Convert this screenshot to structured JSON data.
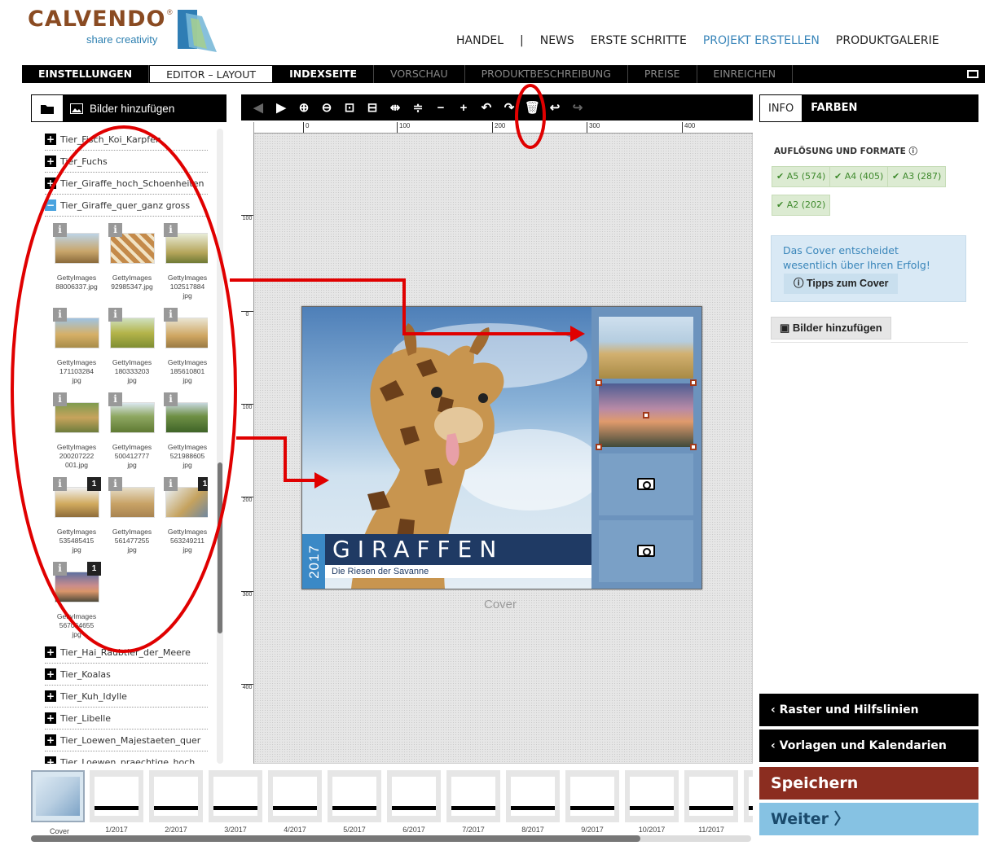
{
  "header": {
    "brand": "CALVENDO",
    "registered": "®",
    "tagline": "share creativity",
    "nav": [
      "HANDEL",
      "|",
      "NEWS",
      "ERSTE SCHRITTE",
      "PROJEKT ERSTELLEN",
      "PRODUKTGALERIE"
    ]
  },
  "tabs": [
    "EINSTELLUNGEN",
    "EDITOR – LAYOUT",
    "INDEXSEITE",
    "VORSCHAU",
    "PRODUKTBESCHREIBUNG",
    "PREISE",
    "EINREICHEN"
  ],
  "left_panel": {
    "add_images": "Bilder hinzufügen",
    "folders_top": [
      {
        "name": "Tier_Fisch_Koi_Karpfen",
        "state": "+"
      },
      {
        "name": "Tier_Fuchs",
        "state": "+"
      },
      {
        "name": "Tier_Giraffe_hoch_Schoenheiten",
        "state": "+"
      },
      {
        "name": "Tier_Giraffe_quer_ganz gross",
        "state": "−"
      }
    ],
    "thumbs": [
      {
        "cap1": "GettyImages",
        "cap2": "88006337.jpg",
        "cap3": "",
        "count": ""
      },
      {
        "cap1": "GettyImages",
        "cap2": "92985347.jpg",
        "cap3": "",
        "count": ""
      },
      {
        "cap1": "GettyImages",
        "cap2": "102517884",
        "cap3": "jpg",
        "count": ""
      },
      {
        "cap1": "GettyImages",
        "cap2": "171103284",
        "cap3": "jpg",
        "count": ""
      },
      {
        "cap1": "GettyImages",
        "cap2": "180333203",
        "cap3": "jpg",
        "count": ""
      },
      {
        "cap1": "GettyImages",
        "cap2": "185610801",
        "cap3": "jpg",
        "count": ""
      },
      {
        "cap1": "GettyImages",
        "cap2": "200207222",
        "cap3": "001.jpg",
        "count": ""
      },
      {
        "cap1": "GettyImages",
        "cap2": "500412777",
        "cap3": "jpg",
        "count": ""
      },
      {
        "cap1": "GettyImages",
        "cap2": "521988605",
        "cap3": "jpg",
        "count": ""
      },
      {
        "cap1": "GettyImages",
        "cap2": "535485415",
        "cap3": "jpg",
        "count": "1"
      },
      {
        "cap1": "GettyImages",
        "cap2": "561477255",
        "cap3": "jpg",
        "count": ""
      },
      {
        "cap1": "GettyImages",
        "cap2": "563249211",
        "cap3": "jpg",
        "count": "1"
      },
      {
        "cap1": "GettyImages",
        "cap2": "567064655",
        "cap3": "jpg",
        "count": "1"
      }
    ],
    "folders_bottom": [
      {
        "name": "Tier_Hai_Raubtier_der_Meere",
        "state": "+"
      },
      {
        "name": "Tier_Koalas",
        "state": "+"
      },
      {
        "name": "Tier_Kuh_Idylle",
        "state": "+"
      },
      {
        "name": "Tier_Libelle",
        "state": "+"
      },
      {
        "name": "Tier_Loewen_Majestaeten_quer",
        "state": "+"
      },
      {
        "name": "Tier_Loewen_praechtige_hoch",
        "state": "+"
      }
    ]
  },
  "ruler": {
    "top": [
      "0",
      "100",
      "200",
      "300",
      "400"
    ],
    "left": [
      "100",
      "0",
      "100",
      "200",
      "300",
      "400"
    ]
  },
  "cover": {
    "year": "2017",
    "title": "GIRAFFEN",
    "subtitle": "Die Riesen der Savanne",
    "label": "Cover"
  },
  "right_panel": {
    "tabs": [
      "INFO",
      "FARBEN"
    ],
    "resolution_heading": "AUFLÖSUNG UND FORMATE",
    "formats": [
      "A5 (574)",
      "A4 (405)",
      "A3 (287)",
      "A2 (202)"
    ],
    "tip_text": "Das Cover entscheidet wesentlich über Ihren Erfolg!",
    "tip_button": "Tipps zum Cover",
    "add_images": "Bilder hinzufügen",
    "grid_bar": "Raster und Hilfslinien",
    "templates_bar": "Vorlagen und Kalendarien",
    "save": "Speichern",
    "next": "Weiter"
  },
  "filmstrip": [
    "Cover",
    "1/2017",
    "2/2017",
    "3/2017",
    "4/2017",
    "5/2017",
    "6/2017",
    "7/2017",
    "8/2017",
    "9/2017",
    "10/2017",
    "11/2017"
  ],
  "colors": {
    "accent_red": "#e00000",
    "brand": "#8a4b22",
    "save": "#8b2d20",
    "next": "#86c2e3"
  }
}
